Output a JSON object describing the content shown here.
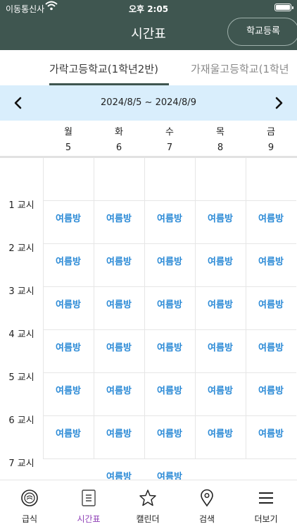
{
  "status_bar": {
    "carrier": "이동통신사",
    "time": "오후 2:05"
  },
  "header": {
    "title": "시간표",
    "register_label": "학교등록"
  },
  "school_tabs": [
    {
      "label": "가락고등학교(1학년2반)",
      "active": true
    },
    {
      "label": "가재울고등학교(1학년",
      "active": false
    }
  ],
  "week": {
    "range": "2024/8/5 ~ 2024/8/9"
  },
  "days": [
    {
      "name": "월",
      "date": "5"
    },
    {
      "name": "화",
      "date": "6"
    },
    {
      "name": "수",
      "date": "7"
    },
    {
      "name": "목",
      "date": "8"
    },
    {
      "name": "금",
      "date": "9"
    }
  ],
  "periods": [
    {
      "label": "1 교시",
      "cells": [
        "여름방",
        "여름방",
        "여름방",
        "여름방",
        "여름방"
      ]
    },
    {
      "label": "2 교시",
      "cells": [
        "여름방",
        "여름방",
        "여름방",
        "여름방",
        "여름방"
      ]
    },
    {
      "label": "3 교시",
      "cells": [
        "여름방",
        "여름방",
        "여름방",
        "여름방",
        "여름방"
      ]
    },
    {
      "label": "4 교시",
      "cells": [
        "여름방",
        "여름방",
        "여름방",
        "여름방",
        "여름방"
      ]
    },
    {
      "label": "5 교시",
      "cells": [
        "여름방",
        "여름방",
        "여름방",
        "여름방",
        "여름방"
      ]
    },
    {
      "label": "6 교시",
      "cells": [
        "여름방",
        "여름방",
        "여름방",
        "여름방",
        "여름방"
      ]
    },
    {
      "label": "7 교시",
      "cells": [
        "",
        "여름방",
        "여름방",
        "",
        ""
      ]
    }
  ],
  "bottom_nav": [
    {
      "label": "급식",
      "icon": "meal-plate-icon",
      "active": false
    },
    {
      "label": "시간표",
      "icon": "timetable-icon",
      "active": true
    },
    {
      "label": "캘린더",
      "icon": "star-icon",
      "active": false
    },
    {
      "label": "검색",
      "icon": "location-pin-icon",
      "active": false
    },
    {
      "label": "더보기",
      "icon": "menu-icon",
      "active": false
    }
  ],
  "colors": {
    "header": "#3f5650",
    "accent_text": "#2b8ad6",
    "active_nav": "#8e3fb6",
    "week_bar": "#d9eefc"
  }
}
